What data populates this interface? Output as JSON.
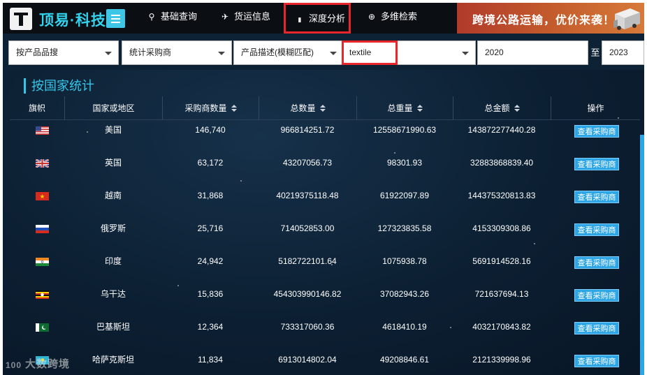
{
  "header": {
    "brand": "顶易·科技",
    "nav": [
      {
        "label": "基础查询",
        "icon": "person-search-icon",
        "glyph": "⚲"
      },
      {
        "label": "货运信息",
        "icon": "airplane-icon",
        "glyph": "✈"
      },
      {
        "label": "深度分析",
        "icon": "chart-bars-icon",
        "glyph": "▮"
      },
      {
        "label": "多维检索",
        "icon": "crosshair-icon",
        "glyph": "⊕"
      }
    ],
    "active_nav": "深度分析",
    "banner_text": "跨境公路运输，优价来袭！"
  },
  "filters": {
    "search_type": "按产品品搜",
    "stat_type": "统计采购商",
    "match_mode": "产品描述(模糊匹配)",
    "keyword": "textile",
    "year_from": "2020",
    "to_label": "至",
    "year_to": "2023"
  },
  "section": {
    "title": "按国家统计"
  },
  "table": {
    "columns": [
      "旗帜",
      "国家或地区",
      "采购商数量",
      "总数量",
      "总重量",
      "总金额",
      "操作"
    ],
    "rows": [
      {
        "flag": "us",
        "country": "美国",
        "buyers": "146,740",
        "quantity": "966814251.72",
        "weight": "12558671990.63",
        "amount": "143872277440.28",
        "action": "查看采购商"
      },
      {
        "flag": "gb",
        "country": "英国",
        "buyers": "63,172",
        "quantity": "43207056.73",
        "weight": "98301.93",
        "amount": "32883868839.40",
        "action": "查看采购商"
      },
      {
        "flag": "vn",
        "country": "越南",
        "buyers": "31,868",
        "quantity": "40219375118.48",
        "weight": "61922097.89",
        "amount": "144375320813.83",
        "action": "查看采购商"
      },
      {
        "flag": "ru",
        "country": "俄罗斯",
        "buyers": "25,716",
        "quantity": "714052853.00",
        "weight": "127323835.58",
        "amount": "4153309308.86",
        "action": "查看采购商"
      },
      {
        "flag": "in",
        "country": "印度",
        "buyers": "24,942",
        "quantity": "5182722101.64",
        "weight": "1075938.78",
        "amount": "5691914528.16",
        "action": "查看采购商"
      },
      {
        "flag": "ug",
        "country": "乌干达",
        "buyers": "15,836",
        "quantity": "454303990146.82",
        "weight": "37082943.26",
        "amount": "721637694.13",
        "action": "查看采购商"
      },
      {
        "flag": "pk",
        "country": "巴基斯坦",
        "buyers": "12,364",
        "quantity": "733317060.36",
        "weight": "4618410.19",
        "amount": "4032170843.82",
        "action": "查看采购商"
      },
      {
        "flag": "kz",
        "country": "哈萨克斯坦",
        "buyers": "11,834",
        "quantity": "6913014802.04",
        "weight": "49208846.61",
        "amount": "2121339998.96",
        "action": "查看采购商"
      }
    ]
  },
  "watermark": "大数跨境",
  "colors": {
    "accent": "#35c6ea",
    "button": "#2ea6e6",
    "highlight": "#e8262c",
    "background": "#0c1f32"
  }
}
